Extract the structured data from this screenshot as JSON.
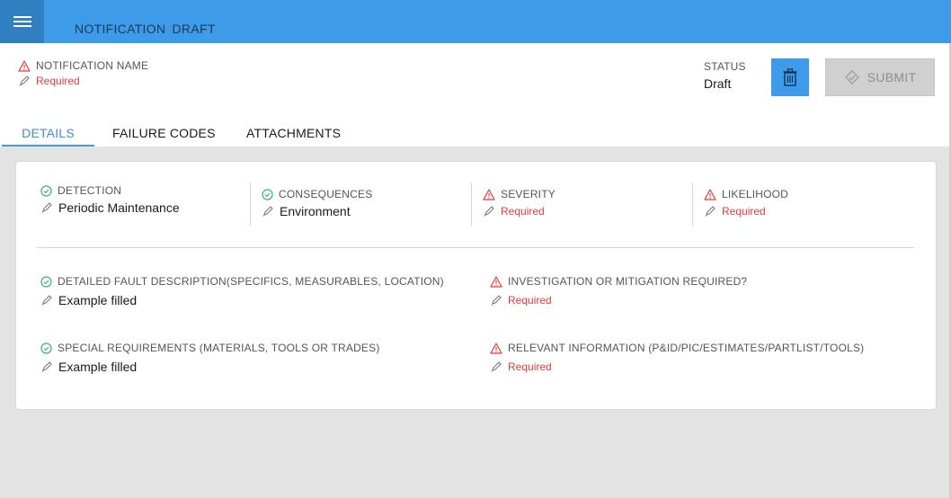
{
  "header": {
    "title": "NOTIFICATION  DRAFT"
  },
  "notification_name": {
    "label": "NOTIFICATION NAME",
    "value": "Required"
  },
  "status": {
    "label": "STATUS",
    "value": "Draft"
  },
  "actions": {
    "submit_label": "SUBMIT"
  },
  "tabs": [
    {
      "label": "DETAILS",
      "active": true
    },
    {
      "label": "FAILURE CODES",
      "active": false
    },
    {
      "label": "ATTACHMENTS",
      "active": false
    }
  ],
  "fields": {
    "detection": {
      "label": "DETECTION",
      "value": "Periodic Maintenance",
      "state": "ok"
    },
    "consequences": {
      "label": "CONSEQUENCES",
      "value": "Environment",
      "state": "ok"
    },
    "severity": {
      "label": "SEVERITY",
      "value": "Required",
      "state": "required"
    },
    "likelihood": {
      "label": "LIKELIHOOD",
      "value": "Required",
      "state": "required"
    },
    "fault_description": {
      "label": "DETAILED FAULT DESCRIPTION(SPECIFICS, MEASURABLES, LOCATION)",
      "value": "Example filled",
      "state": "ok"
    },
    "investigation": {
      "label": "INVESTIGATION OR MITIGATION REQUIRED?",
      "value": "Required",
      "state": "required"
    },
    "special_requirements": {
      "label": "SPECIAL REQUIREMENTS (MATERIALS, TOOLS OR TRADES)",
      "value": "Example filled",
      "state": "ok"
    },
    "relevant_info": {
      "label": "RELEVANT INFORMATION (P&ID/PIC/ESTIMATES/PARTLIST/TOOLS)",
      "value": "Required",
      "state": "required"
    }
  },
  "colors": {
    "accent": "#3d9be9",
    "required": "#e23b3b",
    "ok": "#3cb371"
  }
}
